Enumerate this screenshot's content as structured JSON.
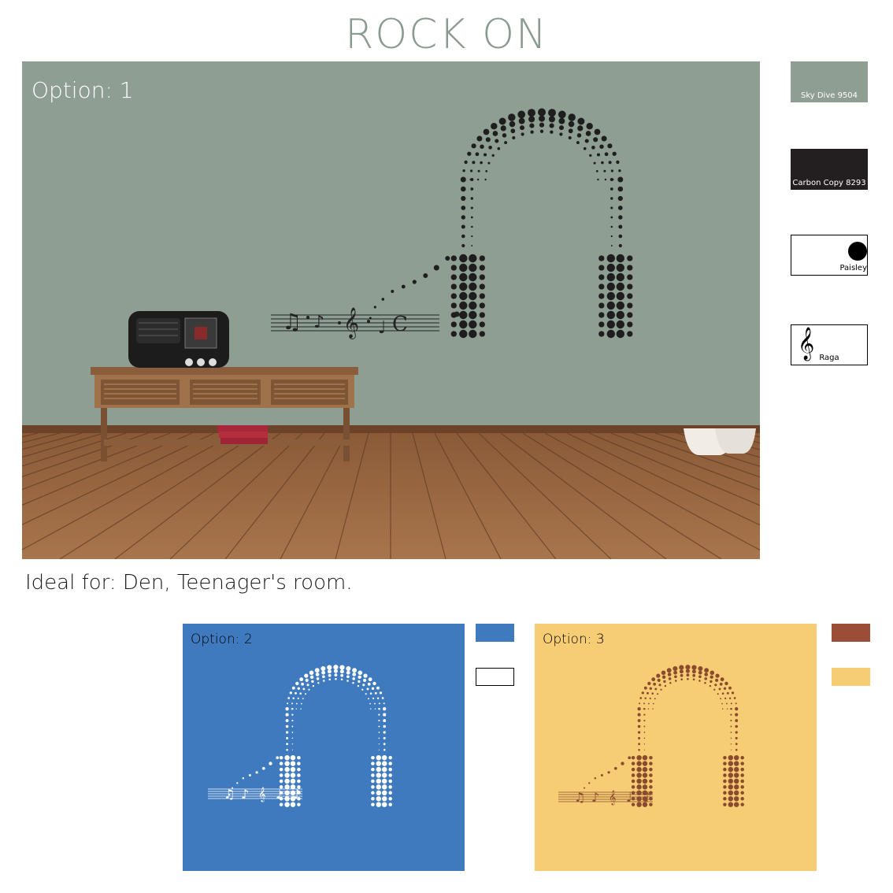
{
  "title": "ROCK ON",
  "main_option": {
    "label": "Option: 1",
    "wall_color": "#8e9e92"
  },
  "swatches": [
    {
      "name": "Sky Dive 9504",
      "color": "#8e9e92",
      "text_color": "#ffffff"
    },
    {
      "name": "Carbon Copy 8293",
      "color": "#231f20",
      "text_color": "#ffffff"
    },
    {
      "name": "Paisley",
      "color": "#ffffff",
      "text_color": "#000000",
      "icon": "dot-icon"
    },
    {
      "name": "Raga",
      "color": "#ffffff",
      "text_color": "#000000",
      "icon": "treble-clef-icon"
    }
  ],
  "ideal_for": "Ideal for: Den, Teenager's room.",
  "option2": {
    "label": "Option: 2",
    "bg": "#3f7abf",
    "fg": "#ffffff",
    "chips": [
      "#3f7abf",
      "#ffffff"
    ]
  },
  "option3": {
    "label": "Option: 3",
    "bg": "#f6cd74",
    "fg": "#8b4a2e",
    "chips": [
      "#9b4e37",
      "#f6cd74"
    ]
  }
}
